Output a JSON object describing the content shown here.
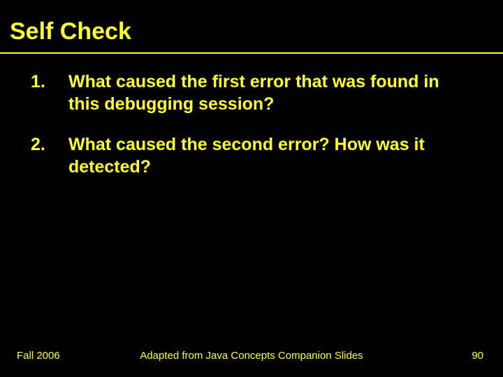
{
  "title": "Self Check",
  "items": [
    {
      "num": "1.",
      "text": "What caused the first error that was found in this debugging session?"
    },
    {
      "num": "2.",
      "text": "What caused the second error? How was it detected?"
    }
  ],
  "footer": {
    "left": "Fall 2006",
    "center": "Adapted from Java Concepts Companion Slides",
    "right": "90"
  }
}
